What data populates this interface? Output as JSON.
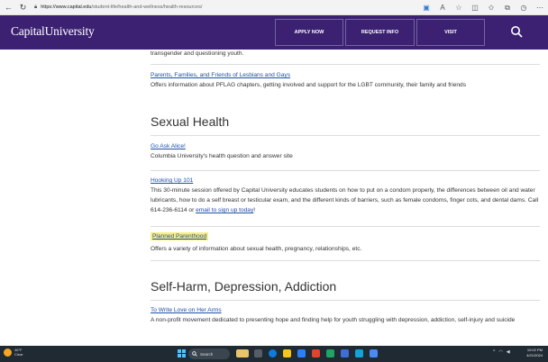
{
  "browser": {
    "url_host": "https://www.capital.edu",
    "url_path": "/student-life/health-and-wellness/health-resources/"
  },
  "header": {
    "logo": "CapitalUniversity",
    "nav": [
      "APPLY NOW",
      "REQUEST INFO",
      "VISIT"
    ],
    "accent_color": "#3c2172"
  },
  "content": {
    "lead_text": "transgender and questioning youth.",
    "pflag": {
      "link": "Parents, Families, and Friends of Lesbians and Gays",
      "desc": "Offers information about PFLAG chapters, getting involved and support for the LGBT community, their family and friends"
    },
    "sexual_health": {
      "title": "Sexual Health",
      "items": [
        {
          "link": "Go Ask Alice!",
          "desc": "Columbia University's health question and answer site"
        },
        {
          "link": "Hooking Up 101",
          "desc": "This 30-minute session offered by Capital University educates students on how to put on a condom properly, the differences between oil and water lubricants, how to do a self breast or testicular exam, and the different kinds of barriers, such as female condoms, finger cots, and dental dams.  Call 614-236-6114 or",
          "cta": "email to sign up today",
          "cta_suffix": "!"
        },
        {
          "link": "Planned Parenthood",
          "desc": "Offers a variety of information about sexual health, pregnancy, relationships, etc."
        }
      ]
    },
    "self_harm": {
      "title": "Self-Harm, Depression, Addiction",
      "items": [
        {
          "link": "To Write Love on Her Arms",
          "desc": "A non-profit movement dedicated to presenting hope and finding help for youth struggling with depression, addiction, self-injury and suicide"
        }
      ]
    }
  },
  "taskbar": {
    "weather_temp": "46°F",
    "weather_cond": "Clear",
    "search_label": "Search",
    "time": "10:02 PM",
    "date": "4/21/2024"
  }
}
